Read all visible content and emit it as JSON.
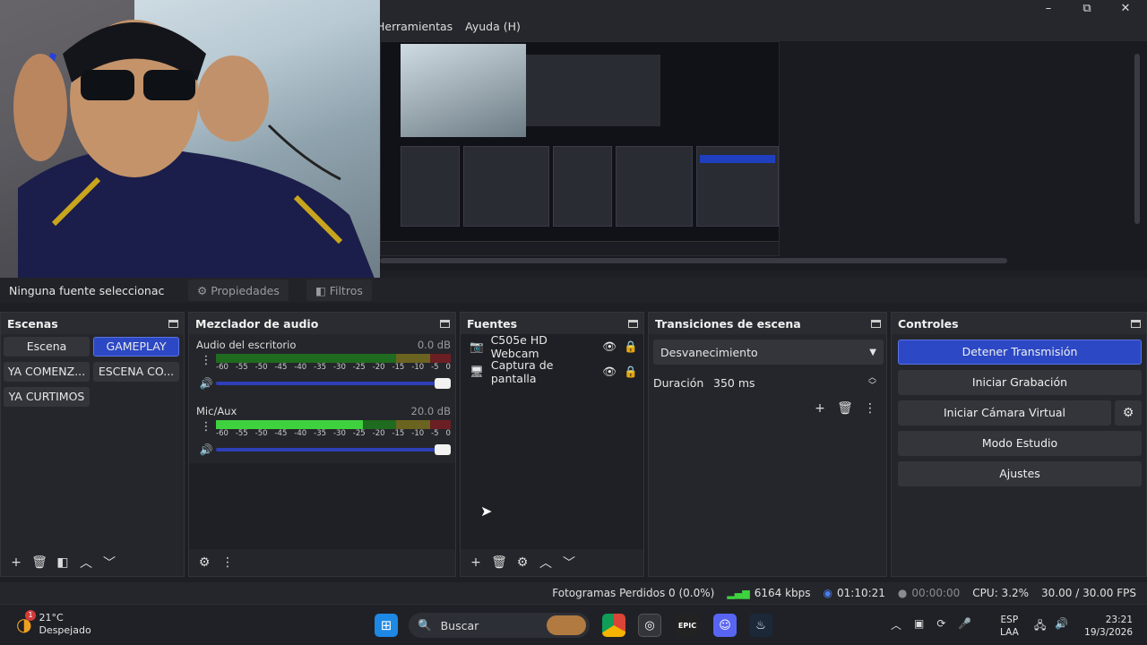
{
  "menu": {
    "items": [
      "Herramientas",
      "Ayuda (H)"
    ]
  },
  "window_controls": {
    "minimize": "–",
    "maximize": "⧉",
    "close": "✕"
  },
  "source_toolbar": {
    "selected_text": "Ninguna fuente seleccionac",
    "properties": "Propiedades",
    "filters": "Filtros"
  },
  "scenes": {
    "title": "Escenas",
    "items": [
      "Escena",
      "GAMEPLAY",
      "YA COMENZ...",
      "ESCENA CO...",
      "YA CURTIMOS"
    ],
    "active": "GAMEPLAY"
  },
  "mixer": {
    "title": "Mezclador de audio",
    "channels": [
      {
        "name": "Audio del escritorio",
        "db": "0.0 dB",
        "level_pct": 0
      },
      {
        "name": "Mic/Aux",
        "db": "20.0 dB",
        "level_pct": 62
      }
    ],
    "scale": [
      "-60",
      "-55",
      "-50",
      "-45",
      "-40",
      "-35",
      "-30",
      "-25",
      "-20",
      "-15",
      "-10",
      "-5",
      "0"
    ]
  },
  "sources": {
    "title": "Fuentes",
    "items": [
      {
        "name": "C505e HD Webcam",
        "icon": "camera-icon",
        "locked": false
      },
      {
        "name": "Captura de pantalla",
        "icon": "monitor-icon",
        "locked": true
      }
    ]
  },
  "transitions": {
    "title": "Transiciones de escena",
    "selected": "Desvanecimiento",
    "duration_label": "Duración",
    "duration_value": "350 ms"
  },
  "controls": {
    "title": "Controles",
    "stop_stream": "Detener Transmisión",
    "start_recording": "Iniciar Grabación",
    "virtual_cam": "Iniciar Cámara Virtual",
    "studio_mode": "Modo Estudio",
    "settings": "Ajustes"
  },
  "status": {
    "dropped_frames": "Fotogramas Perdidos 0 (0.0%)",
    "bitrate": "6164 kbps",
    "stream_time": "01:10:21",
    "rec_time": "00:00:00",
    "cpu": "CPU: 3.2%",
    "fps": "30.00 / 30.00 FPS"
  },
  "taskbar": {
    "weather_temp": "21°C",
    "weather_desc": "Despejado",
    "weather_badge": "1",
    "search": "Buscar",
    "lang_top": "ESP",
    "lang_bottom": "LAA",
    "time": "23:21",
    "date": "19/3/2026"
  },
  "colors": {
    "accent": "#2c48c4",
    "meter_green": "#3fd23f",
    "meter_yellow": "#c8b63a",
    "meter_red": "#c8303a"
  }
}
